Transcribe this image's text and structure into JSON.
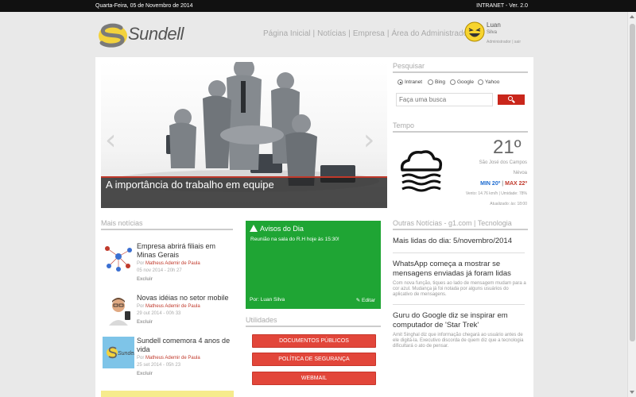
{
  "topbar": {
    "date": "Quarta-Feira, 05 de Novembro de 2014",
    "version": "INTRANET - Ver. 2.0"
  },
  "logo": {
    "text": "Sundell"
  },
  "nav": {
    "items": [
      "Página Inicial",
      "Notícias",
      "Empresa",
      "Área do Administrador"
    ],
    "separator": "|"
  },
  "user": {
    "name": "Luan",
    "surname": "Silva",
    "role": "Administrador | sair"
  },
  "carousel": {
    "caption": "A importância do trabalho em equipe",
    "prev": "‹",
    "next": "›"
  },
  "news": {
    "title": "Mais notícias",
    "author_prefix": "Por",
    "delete_label": "Excluir",
    "items": [
      {
        "title": "Empresa abrirá filiais em Minas Gerais",
        "author": "Matheus Ademir de Paula",
        "date": "05 nov 2014 - 20h 27"
      },
      {
        "title": "Novas idéias no setor mobile",
        "author": "Matheus Ademir de Paula",
        "date": "29 out 2014 - 00h 33"
      },
      {
        "title": "Sundell comemora 4 anos de vida",
        "author": "Matheus Ademir de Paula",
        "date": "25 set 2014 - 05h 23"
      }
    ]
  },
  "avisos": {
    "title": "Avisos do Dia",
    "message": "Reunião na sala do R.H hoje às 15:30!",
    "author": "Por: Luan Silva",
    "edit": "Editar"
  },
  "utilidades": {
    "title": "Utilidades",
    "buttons": [
      "DOCUMENTOS PÚBLICOS",
      "POLÍTICA DE SEGURANÇA",
      "WEBMAIL"
    ]
  },
  "search": {
    "title": "Pesquisar",
    "placeholder": "Faça uma busca",
    "engines": [
      "Intranet",
      "Bing",
      "Google",
      "Yahoo"
    ],
    "selected": "Intranet"
  },
  "weather": {
    "title": "Tempo",
    "temperature": "21º",
    "city": "São José dos Campos",
    "condition": "Névoa",
    "min": "MIN 20º",
    "max": "MAX 22º",
    "minmax_sep": "|",
    "details": "Vento: 14.76 km/h | Umidade: 78%",
    "updated": "Atualizado: às: 18:00",
    "icon": "fog-cloud-icon"
  },
  "g1": {
    "title": "Outras Notícias - g1.com | Tecnologia",
    "items": [
      {
        "title": "Mais lidas do dia: 5/novembro/2014",
        "desc": ""
      },
      {
        "title": "WhatsApp começa a mostrar se mensagens enviadas já foram lidas",
        "desc": "Com nova função, tiques ao lado de mensagem mudam para a cor azul. Mudança já foi notada por alguns usuários do aplicativo de mensagens."
      },
      {
        "title": "Guru do Google diz se inspirar em computador de 'Star Trek'",
        "desc": "Amit Singhal diz que informação chegará ao usuário antes de ele digitá-la. Executivo discorda de quem diz que a tecnologia dificultará o ato de pensar."
      }
    ]
  },
  "colors": {
    "accent_red": "#e2463a",
    "avisos_green": "#1fa534",
    "topbar": "#111111"
  }
}
